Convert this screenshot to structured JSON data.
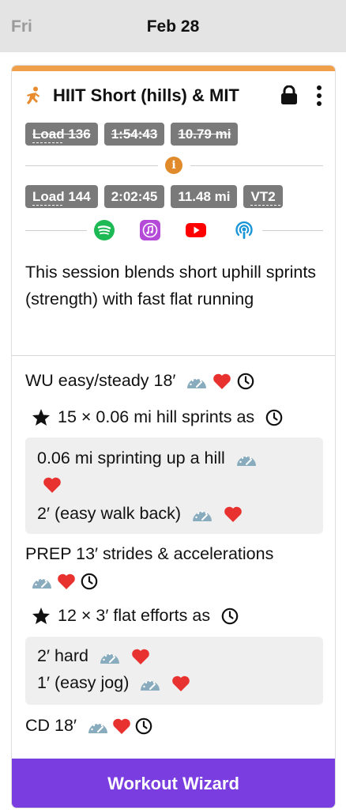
{
  "header": {
    "day": "Fri",
    "date": "Feb 28"
  },
  "workout": {
    "title": "HIIT Short (hills) & MIT",
    "planned": {
      "load": "Load 136",
      "duration": "1:54:43",
      "distance": "10.79 mi"
    },
    "actual": {
      "load": "Load 144",
      "duration": "2:02:45",
      "distance": "11.48 mi",
      "zone": "VT2"
    },
    "accent_color": "#f0a04a",
    "apps": [
      "spotify-icon",
      "itunes-icon",
      "youtube-icon",
      "podcast-icon"
    ],
    "description": "This session blends short uphill sprints (strength) with fast flat running"
  },
  "steps": {
    "wu": "WU easy/steady 18′",
    "hill_set": "15 × 0.06 mi hill sprints as",
    "hill_work": "0.06 mi sprinting up a hill",
    "hill_rest": "2′ (easy walk back)",
    "prep": "PREP 13′ strides & accelerations",
    "flat_set": "12 × 3′ flat efforts as",
    "flat_hard": "2′ hard",
    "flat_easy": "1′ (easy jog)",
    "cd": "CD 18′"
  },
  "footer": {
    "wizard_label": "Workout Wizard",
    "wizard_color": "#7a3ee0"
  }
}
